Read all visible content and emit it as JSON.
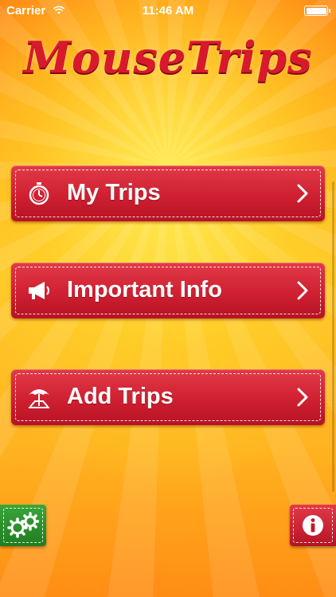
{
  "status_bar": {
    "carrier": "Carrier",
    "time": "11:46 AM",
    "wifi_icon": "wifi-icon",
    "battery_icon": "battery-icon"
  },
  "app": {
    "logo_text": "MouseTrips"
  },
  "menu": [
    {
      "label": "My Trips",
      "icon": "stopwatch-icon"
    },
    {
      "label": "Important Info",
      "icon": "megaphone-icon"
    },
    {
      "label": "Add Trips",
      "icon": "beach-umbrella-icon"
    }
  ],
  "corner_buttons": {
    "settings_icon": "gears-icon",
    "info_icon": "info-icon"
  },
  "colors": {
    "button_red": "#cf2031",
    "settings_green": "#2a8f2c",
    "background_orange": "#ffb320"
  }
}
